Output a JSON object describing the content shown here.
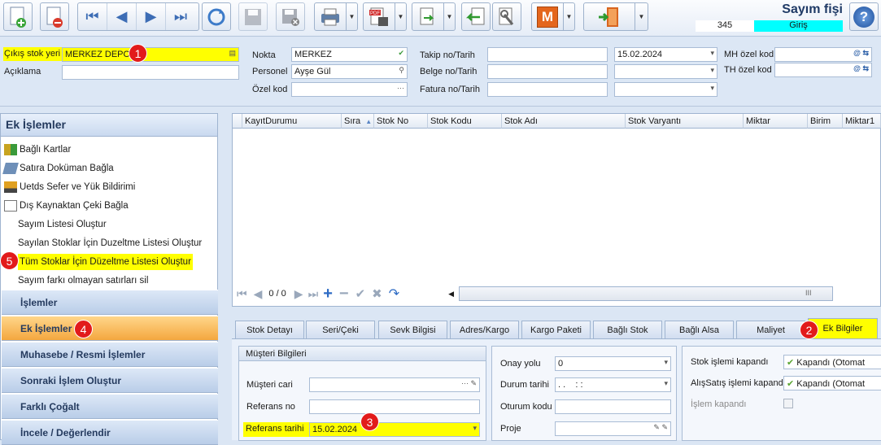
{
  "toolbar": {
    "buttons": [
      "new-document-icon",
      "delete-document-icon",
      "first-record-icon",
      "previous-record-icon",
      "next-record-icon",
      "last-record-icon",
      "refresh-icon",
      "save-icon",
      "save-close-icon",
      "print-icon",
      "pdf-icon",
      "export-icon",
      "import-icon",
      "tools-icon",
      "m-module-icon",
      "exit-door-icon"
    ],
    "m_label": "M",
    "doc_title": "Sayım fişi",
    "doc_number": "345",
    "doc_type": "Giriş",
    "help_label": "?"
  },
  "form": {
    "cikis_stok_yeri_label": "Çıkış stok yeri",
    "cikis_stok_yeri_value": "MERKEZ DEPO",
    "aciklama_label": "Açıklama",
    "aciklama_value": "",
    "nokta_label": "Nokta",
    "nokta_value": "MERKEZ",
    "personel_label": "Personel",
    "personel_value": "Ayşe Gül",
    "ozel_kod_label": "Özel kod",
    "ozel_kod_value": "",
    "takip_label": "Takip no/Tarih",
    "belge_label": "Belge no/Tarih",
    "fatura_label": "Fatura no/Tarih",
    "takip_date": "15.02.2024",
    "mh_label": "MH özel kod",
    "th_label": "TH özel kod"
  },
  "badges": [
    "1",
    "2",
    "3",
    "4",
    "5"
  ],
  "left_panel": {
    "title": "Ek İşlemler",
    "items": [
      {
        "label": "Bağlı Kartlar",
        "icon": "linked-cards-icon"
      },
      {
        "label": "Satıra Doküman Bağla",
        "icon": "attach-document-icon"
      },
      {
        "label": "Uetds Sefer ve Yük Bildirimi",
        "icon": "truck-icon"
      },
      {
        "label": "Dış Kaynaktan Çeki Bağla",
        "icon": "external-source-icon"
      },
      {
        "label": "Sayım Listesi Oluştur",
        "icon": ""
      },
      {
        "label": "Sayılan Stoklar İçin Duzeltme Listesi Oluştur",
        "icon": ""
      },
      {
        "label": "Tüm Stoklar İçin Düzeltme Listesi Oluştur",
        "icon": ""
      },
      {
        "label": "Sayım farkı olmayan satırları sil",
        "icon": ""
      }
    ],
    "sections": [
      "İşlemler",
      "Ek İşlemler",
      "Muhasebe / Resmi İşlemler",
      "Sonraki İşlem Oluştur",
      "Farklı Çoğalt",
      "İncele / Değerlendir"
    ]
  },
  "grid": {
    "columns": [
      "KayıtDurumu",
      "Sıra",
      "Stok No",
      "Stok Kodu",
      "Stok Adı",
      "Stok Varyantı",
      "Miktar",
      "Birim",
      "Miktar1"
    ],
    "record_counter": "0 / 0",
    "scroll_marker": "III"
  },
  "tabs": [
    "Stok Detayı",
    "Seri/Çeki",
    "Sevk Bilgisi",
    "Adres/Kargo",
    "Kargo Paketi",
    "Bağlı Stok",
    "Bağlı Alsa",
    "Maliyet",
    "Ek Bilgiler"
  ],
  "ek_bilgiler": {
    "musteri_title": "Müşteri Bilgileri",
    "musteri_cari_label": "Müşteri cari",
    "referans_no_label": "Referans no",
    "referans_tarihi_label": "Referans tarihi",
    "referans_tarihi_value": "15.02.2024",
    "onay_yolu_label": "Onay yolu",
    "onay_yolu_value": "0",
    "durum_tarihi_label": "Durum tarihi",
    "durum_tarihi_value": ". .    : :",
    "oturum_kodu_label": "Oturum kodu",
    "proje_label": "Proje",
    "stok_islemi_label": "Stok işlemi kapandı",
    "stok_islemi_value": "Kapandı (Otomat",
    "alissatis_label": "AlışSatış işlemi kapandı",
    "alissatis_value": "Kapandı (Otomat",
    "islem_kapandi_label": "İşlem kapandı"
  }
}
